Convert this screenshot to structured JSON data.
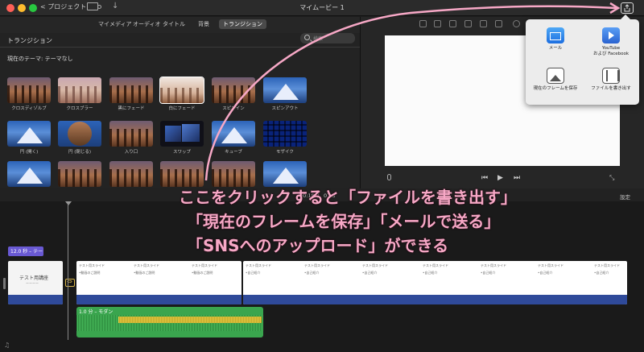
{
  "window": {
    "title": "マイムービー 1",
    "back_label": "< プロジェクト"
  },
  "browser_tabs": [
    "マイメディア",
    "オーディオ",
    "タイトル",
    "背景",
    "トランジション"
  ],
  "panel": {
    "title": "トランジション",
    "search_placeholder": "検索",
    "theme_label": "現在のテーマ: テーマなし"
  },
  "transitions": [
    {
      "label": "クロスディゾルブ",
      "style": "forest"
    },
    {
      "label": "クロスブラー",
      "style": "pink"
    },
    {
      "label": "黒にフェード",
      "style": "forest"
    },
    {
      "label": "白にフェード",
      "style": "white"
    },
    {
      "label": "スピンイン",
      "style": "forest"
    },
    {
      "label": "スピンアウト",
      "style": "mountain"
    },
    {
      "label": "円 (開く)",
      "style": "mountain"
    },
    {
      "label": "円 (閉じる)",
      "style": "circle"
    },
    {
      "label": "入り口",
      "style": "forest"
    },
    {
      "label": "スワップ",
      "style": "dark"
    },
    {
      "label": "キューブ",
      "style": "mountain"
    },
    {
      "label": "モザイク",
      "style": "mosaic"
    },
    {
      "label": "",
      "style": "mountain"
    },
    {
      "label": "",
      "style": "forest"
    },
    {
      "label": "",
      "style": "forest"
    },
    {
      "label": "",
      "style": "forest"
    },
    {
      "label": "",
      "style": "forest"
    },
    {
      "label": "",
      "style": "mountain"
    }
  ],
  "share_menu": [
    {
      "label": "メール",
      "icon": "mail-icon"
    },
    {
      "label": "YouTube\nおよび Facebook",
      "icon": "youtube-icon"
    },
    {
      "label": "現在のフレームを保存",
      "icon": "frame-icon"
    },
    {
      "label": "ファイルを書き出す",
      "icon": "film-icon"
    }
  ],
  "annotation": {
    "line1": "ここをクリックすると「ファイルを書き出す」",
    "line2": "「現在のフレームを保存」「メールで送る」",
    "line3": "「SNSへのアップロード」ができる",
    "color": "#f7a8c6"
  },
  "timeline": {
    "timecode_current": "00:18",
    "timecode_separator": "/",
    "timecode_total": "07:3",
    "settings_label": "設定",
    "title_clip_label": "12.0 秒 – テー",
    "title_clip_text": "テスト用講座",
    "title_clip_sub": "ーーーー",
    "audio_label": "1.0 分 – モダン",
    "slide_title": "テスト用スライド",
    "slide_bullet_a": "•動画のご説明",
    "slide_bullet_b": "•自己紹介"
  }
}
